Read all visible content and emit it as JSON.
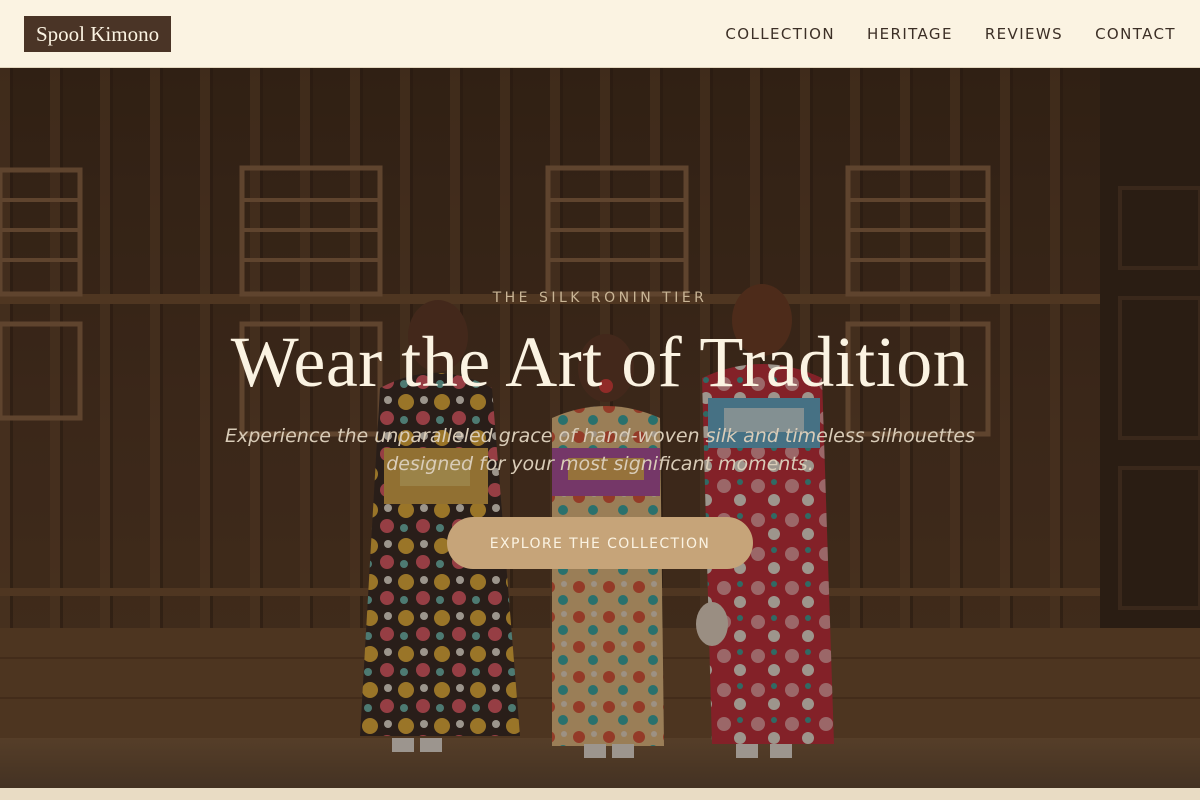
{
  "header": {
    "logo": "Spool Kimono",
    "nav": [
      "COLLECTION",
      "HERITAGE",
      "REVIEWS",
      "CONTACT"
    ]
  },
  "hero": {
    "eyebrow": "THE SILK RONIN TIER",
    "headline": "Wear the Art of Tradition",
    "subhead": "Experience the unparalleled grace of hand-woven silk and timeless silhouettes designed for your most significant moments.",
    "cta": "EXPLORE THE COLLECTION"
  },
  "colors": {
    "header_bg": "#fbf3e2",
    "logo_bg": "#4a3426",
    "cta_bg": "#c6a479",
    "text_light": "#fbf3e2"
  }
}
